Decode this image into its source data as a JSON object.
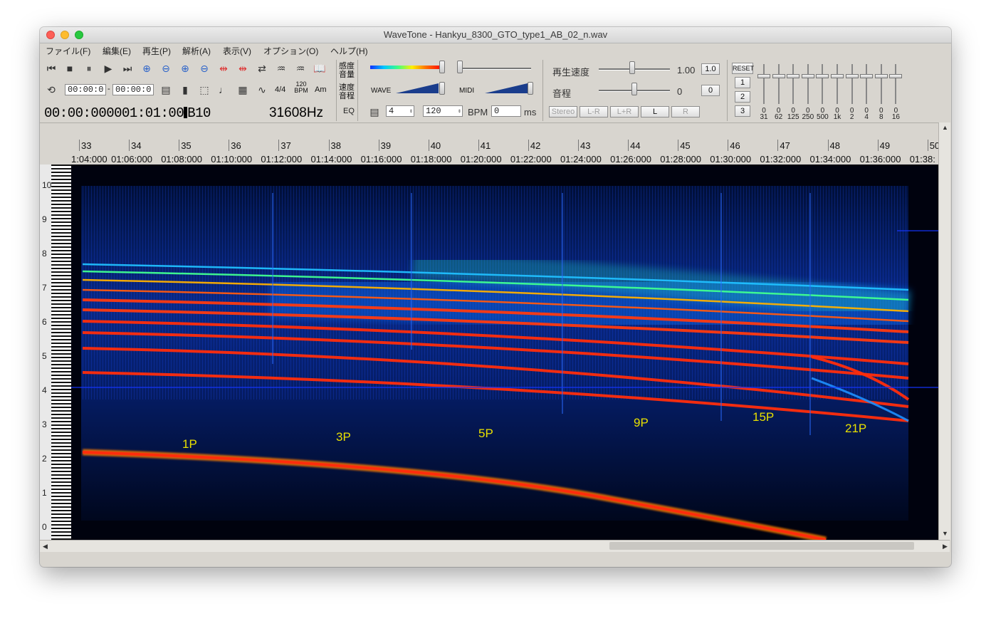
{
  "window": {
    "title": "WaveTone - Hankyu_8300_GTO_type1_AB_02_n.wav"
  },
  "menu": [
    "ファイル(F)",
    "編集(E)",
    "再生(P)",
    "解析(A)",
    "表示(V)",
    "オプション(O)",
    "ヘルプ(H)"
  ],
  "toolbar": {
    "range_start": "00:00:0",
    "range_dash": "-",
    "range_end": "00:00:0",
    "time_sig": "4/4",
    "bpm_icon_top": "120",
    "bpm_icon_bottom": "BPM",
    "chord_icon": "Am",
    "position_time": "00:00:000001:01:00",
    "position_note": "B10",
    "frequency": "31608Hz",
    "eq_label": "EQ",
    "sensitivity_label": "感度",
    "volume_label": "音量",
    "speed_label": "速度",
    "pitch_label": "音程",
    "wave_label": "WAVE",
    "midi_label": "MIDI",
    "beats_value": "4",
    "tempo_value": "120",
    "bpm_label": "BPM",
    "ms_value": "0",
    "ms_label": "ms"
  },
  "playback": {
    "speed_label": "再生速度",
    "speed_value": "1.00",
    "speed_reset": "1.0",
    "pitch_label": "音程",
    "pitch_value": "0",
    "pitch_reset": "0",
    "channels": [
      "Stereo",
      "L-R",
      "L+R",
      "L",
      "R"
    ]
  },
  "equalizer": {
    "reset_label": "RESET",
    "presets": [
      "1",
      "2",
      "3"
    ],
    "bands": [
      {
        "value": "0",
        "freq": "31"
      },
      {
        "value": "0",
        "freq": "62"
      },
      {
        "value": "0",
        "freq": "125"
      },
      {
        "value": "0",
        "freq": "250"
      },
      {
        "value": "0",
        "freq": "500"
      },
      {
        "value": "0",
        "freq": "1k"
      },
      {
        "value": "0",
        "freq": "2"
      },
      {
        "value": "0",
        "freq": "4"
      },
      {
        "value": "0",
        "freq": "8"
      },
      {
        "value": "0",
        "freq": "16"
      }
    ]
  },
  "ruler": {
    "bars": [
      "33",
      "34",
      "35",
      "36",
      "37",
      "38",
      "39",
      "40",
      "41",
      "42",
      "43",
      "44",
      "45",
      "46",
      "47",
      "48",
      "49",
      "50"
    ],
    "times": [
      "1:04:000",
      "01:06:000",
      "01:08:000",
      "01:10:000",
      "01:12:000",
      "01:14:000",
      "01:16:000",
      "01:18:000",
      "01:20:000",
      "01:22:000",
      "01:24:000",
      "01:26:000",
      "01:28:000",
      "01:30:000",
      "01:32:000",
      "01:34:000",
      "01:36:000",
      "01:38:"
    ]
  },
  "octaves": [
    "10",
    "9",
    "8",
    "7",
    "6",
    "5",
    "4",
    "3",
    "2",
    "1",
    "0"
  ],
  "annotations": [
    "1P",
    "3P",
    "5P",
    "9P",
    "15P",
    "21P"
  ],
  "colors": {
    "annotation": "#e8e000",
    "harmonic": "#ff3a10",
    "background": "#00020e",
    "noise": "#0a3cff"
  }
}
